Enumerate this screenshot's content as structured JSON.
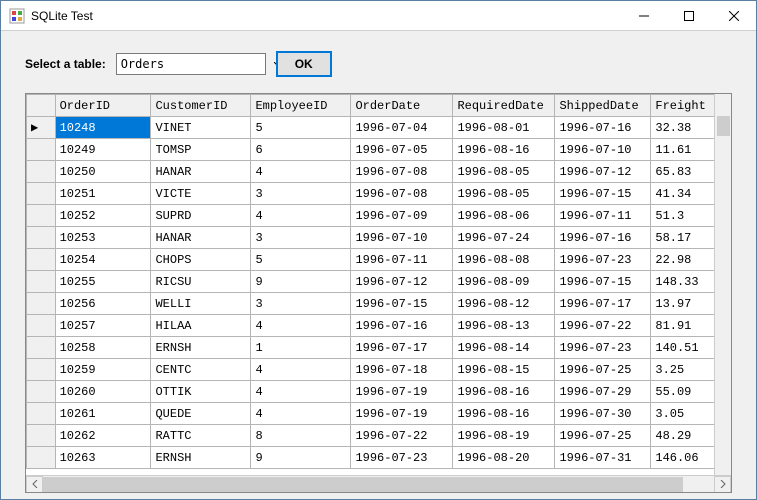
{
  "window": {
    "title": "SQLite Test"
  },
  "toolbar": {
    "label": "Select a table:",
    "combo_value": "Orders",
    "ok_label": "OK"
  },
  "grid": {
    "columns": [
      "OrderID",
      "CustomerID",
      "EmployeeID",
      "OrderDate",
      "RequiredDate",
      "ShippedDate",
      "Freight"
    ],
    "selected_row": 0,
    "selected_col": 0,
    "rows": [
      {
        "OrderID": "10248",
        "CustomerID": "VINET",
        "EmployeeID": "5",
        "OrderDate": "1996-07-04",
        "RequiredDate": "1996-08-01",
        "ShippedDate": "1996-07-16",
        "Freight": "32.38"
      },
      {
        "OrderID": "10249",
        "CustomerID": "TOMSP",
        "EmployeeID": "6",
        "OrderDate": "1996-07-05",
        "RequiredDate": "1996-08-16",
        "ShippedDate": "1996-07-10",
        "Freight": "11.61"
      },
      {
        "OrderID": "10250",
        "CustomerID": "HANAR",
        "EmployeeID": "4",
        "OrderDate": "1996-07-08",
        "RequiredDate": "1996-08-05",
        "ShippedDate": "1996-07-12",
        "Freight": "65.83"
      },
      {
        "OrderID": "10251",
        "CustomerID": "VICTE",
        "EmployeeID": "3",
        "OrderDate": "1996-07-08",
        "RequiredDate": "1996-08-05",
        "ShippedDate": "1996-07-15",
        "Freight": "41.34"
      },
      {
        "OrderID": "10252",
        "CustomerID": "SUPRD",
        "EmployeeID": "4",
        "OrderDate": "1996-07-09",
        "RequiredDate": "1996-08-06",
        "ShippedDate": "1996-07-11",
        "Freight": "51.3"
      },
      {
        "OrderID": "10253",
        "CustomerID": "HANAR",
        "EmployeeID": "3",
        "OrderDate": "1996-07-10",
        "RequiredDate": "1996-07-24",
        "ShippedDate": "1996-07-16",
        "Freight": "58.17"
      },
      {
        "OrderID": "10254",
        "CustomerID": "CHOPS",
        "EmployeeID": "5",
        "OrderDate": "1996-07-11",
        "RequiredDate": "1996-08-08",
        "ShippedDate": "1996-07-23",
        "Freight": "22.98"
      },
      {
        "OrderID": "10255",
        "CustomerID": "RICSU",
        "EmployeeID": "9",
        "OrderDate": "1996-07-12",
        "RequiredDate": "1996-08-09",
        "ShippedDate": "1996-07-15",
        "Freight": "148.33"
      },
      {
        "OrderID": "10256",
        "CustomerID": "WELLI",
        "EmployeeID": "3",
        "OrderDate": "1996-07-15",
        "RequiredDate": "1996-08-12",
        "ShippedDate": "1996-07-17",
        "Freight": "13.97"
      },
      {
        "OrderID": "10257",
        "CustomerID": "HILAA",
        "EmployeeID": "4",
        "OrderDate": "1996-07-16",
        "RequiredDate": "1996-08-13",
        "ShippedDate": "1996-07-22",
        "Freight": "81.91"
      },
      {
        "OrderID": "10258",
        "CustomerID": "ERNSH",
        "EmployeeID": "1",
        "OrderDate": "1996-07-17",
        "RequiredDate": "1996-08-14",
        "ShippedDate": "1996-07-23",
        "Freight": "140.51"
      },
      {
        "OrderID": "10259",
        "CustomerID": "CENTC",
        "EmployeeID": "4",
        "OrderDate": "1996-07-18",
        "RequiredDate": "1996-08-15",
        "ShippedDate": "1996-07-25",
        "Freight": "3.25"
      },
      {
        "OrderID": "10260",
        "CustomerID": "OTTIK",
        "EmployeeID": "4",
        "OrderDate": "1996-07-19",
        "RequiredDate": "1996-08-16",
        "ShippedDate": "1996-07-29",
        "Freight": "55.09"
      },
      {
        "OrderID": "10261",
        "CustomerID": "QUEDE",
        "EmployeeID": "4",
        "OrderDate": "1996-07-19",
        "RequiredDate": "1996-08-16",
        "ShippedDate": "1996-07-30",
        "Freight": "3.05"
      },
      {
        "OrderID": "10262",
        "CustomerID": "RATTC",
        "EmployeeID": "8",
        "OrderDate": "1996-07-22",
        "RequiredDate": "1996-08-19",
        "ShippedDate": "1996-07-25",
        "Freight": "48.29"
      },
      {
        "OrderID": "10263",
        "CustomerID": "ERNSH",
        "EmployeeID": "9",
        "OrderDate": "1996-07-23",
        "RequiredDate": "1996-08-20",
        "ShippedDate": "1996-07-31",
        "Freight": "146.06"
      }
    ]
  }
}
